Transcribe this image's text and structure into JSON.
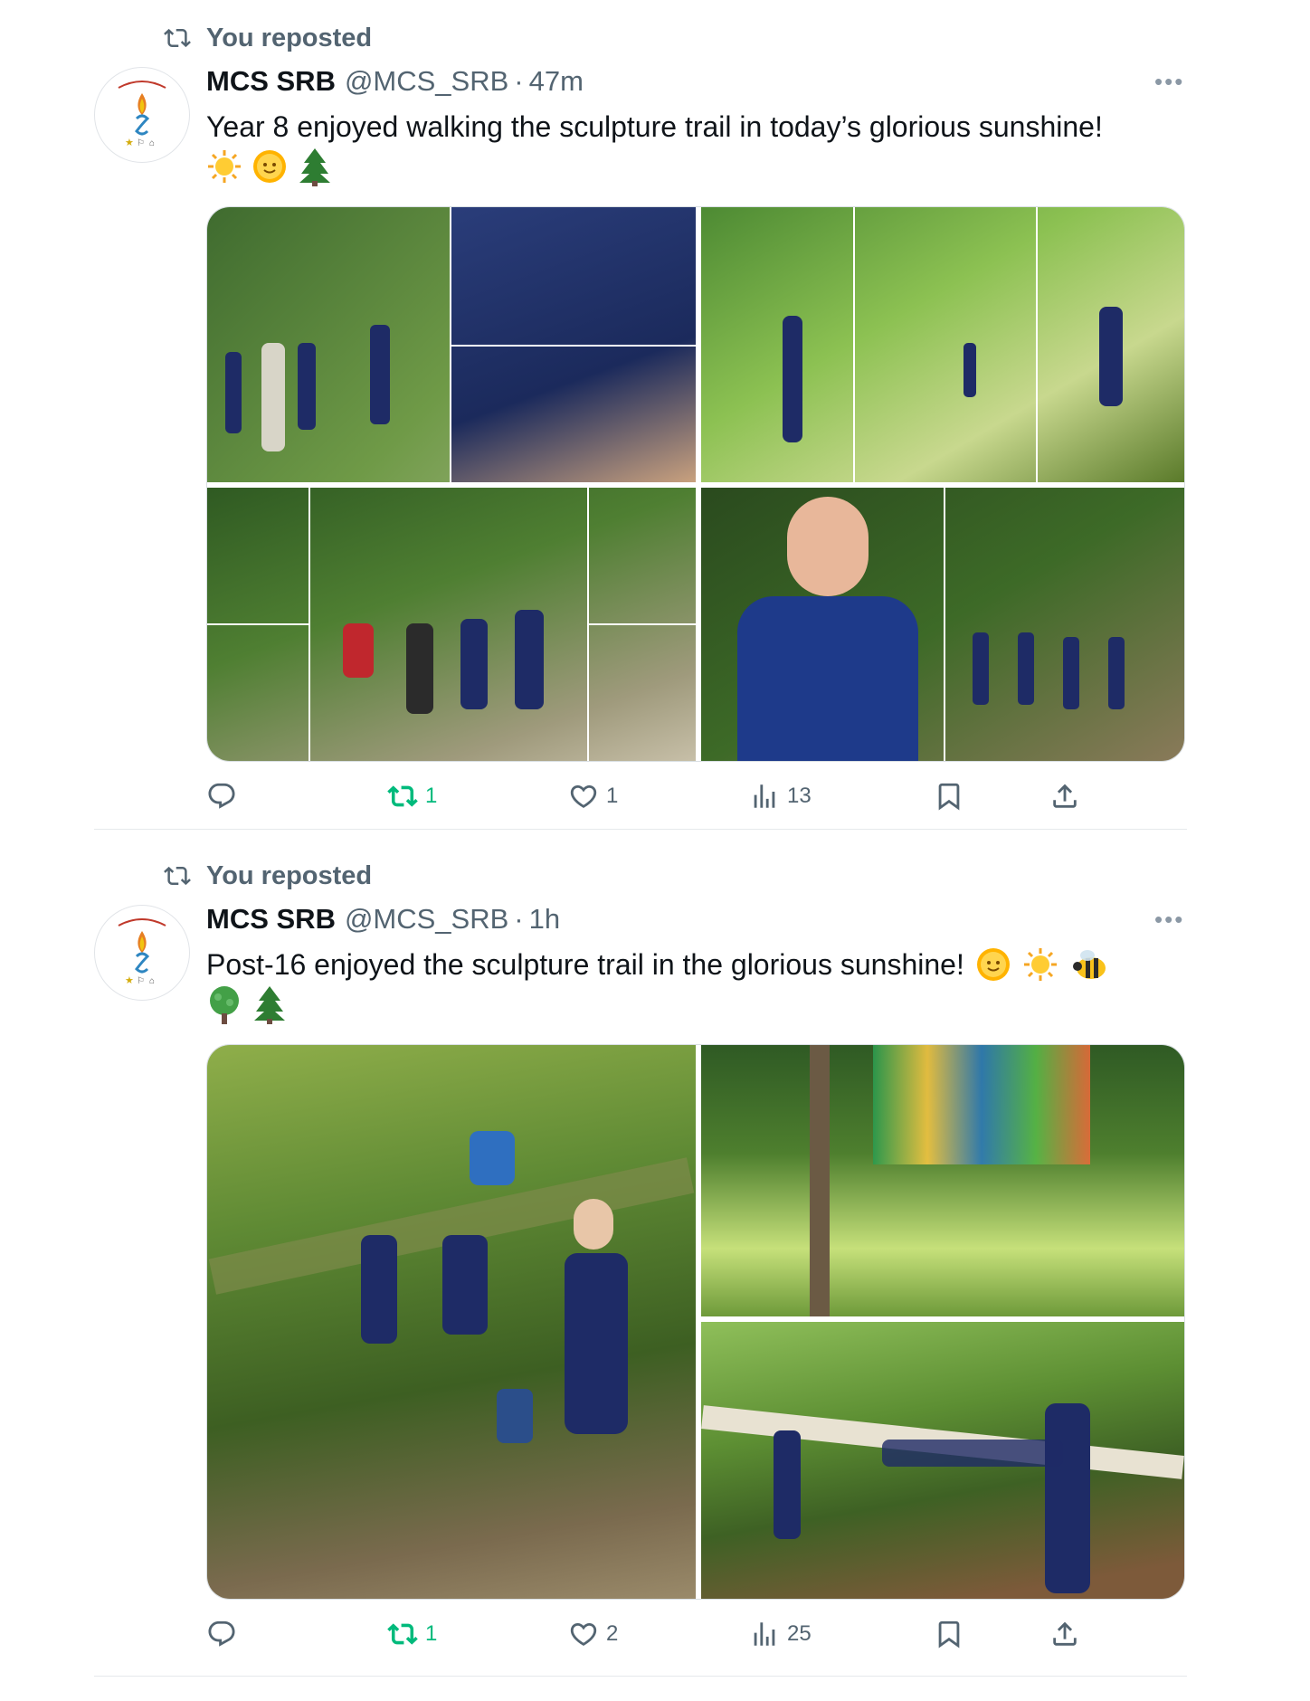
{
  "posts": [
    {
      "repost_label": "You reposted",
      "author_name": "MCS SRB",
      "handle": "@MCS_SRB",
      "separator": "·",
      "time": "47m",
      "text": "Year 8 enjoyed walking the sculpture trail in today’s glorious sunshine!",
      "emojis": [
        "sun",
        "sun-face",
        "evergreen-tree"
      ],
      "more_label": "•••",
      "media_description": "Photo collage of students on the sculpture trail",
      "actions": {
        "reply": "",
        "repost": "1",
        "like": "1",
        "views": "13"
      }
    },
    {
      "repost_label": "You reposted",
      "author_name": "MCS SRB",
      "handle": "@MCS_SRB",
      "separator": "·",
      "time": "1h",
      "text": "Post-16 enjoyed the sculpture trail in the glorious sunshine!",
      "emojis": [
        "sun-face",
        "sun",
        "bee",
        "deciduous-tree",
        "evergreen-tree"
      ],
      "more_label": "•••",
      "media_description": "Photos of Post-16 students in the woods",
      "actions": {
        "reply": "",
        "repost": "1",
        "like": "2",
        "views": "25"
      }
    }
  ],
  "colors": {
    "repost_green": "#00ba7c",
    "muted": "#536471",
    "text": "#0f1419"
  }
}
